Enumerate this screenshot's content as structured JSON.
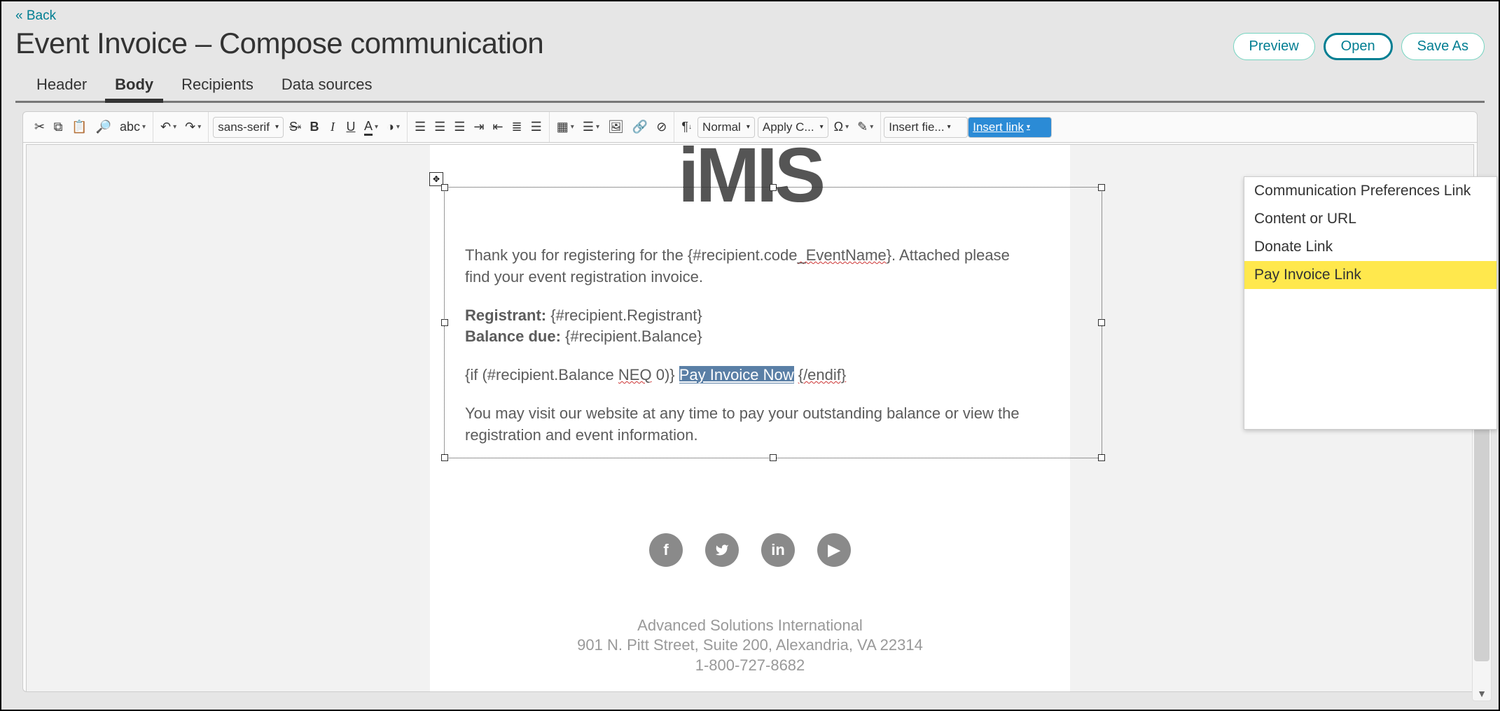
{
  "back_link": "« Back",
  "page_title": "Event Invoice – Compose communication",
  "actions": {
    "preview": "Preview",
    "open": "Open",
    "save_as": "Save As"
  },
  "tabs": {
    "header": "Header",
    "body": "Body",
    "recipients": "Recipients",
    "data_sources": "Data sources"
  },
  "toolbar": {
    "font_family": "sans-serif",
    "paragraph": "Normal",
    "apply_css": "Apply C...",
    "insert_field": "Insert fie...",
    "insert_link": "Insert link"
  },
  "email": {
    "logo": "iMIS",
    "intro_1": "Thank you for registering for the {#recipient.code",
    "intro_event_segment": "_EventName",
    "intro_2": "}. Attached please find your event registration invoice.",
    "registrant_label": "Registrant:",
    "registrant_value": " {#recipient.Registrant}",
    "balance_label": "Balance due:",
    "balance_value": " {#recipient.Balance}",
    "cond_open": "{if (#recipient.Balance ",
    "cond_neq": "NEQ",
    "cond_mid": " 0)} ",
    "pay_link": "Pay Invoice Now",
    "cond_close_space": " ",
    "cond_close": "{/endif}",
    "outro": "You may visit our website at any time to pay your outstanding balance or view the registration and event information.",
    "footer_company": "Advanced Solutions International",
    "footer_address": "901 N. Pitt Street, Suite 200, Alexandria, VA 22314",
    "footer_phone": "1-800-727-8682"
  },
  "dropdown": {
    "items": [
      "Communication Preferences Link",
      "Content or URL",
      "Donate Link",
      "Pay Invoice Link"
    ],
    "highlighted_index": 3
  }
}
